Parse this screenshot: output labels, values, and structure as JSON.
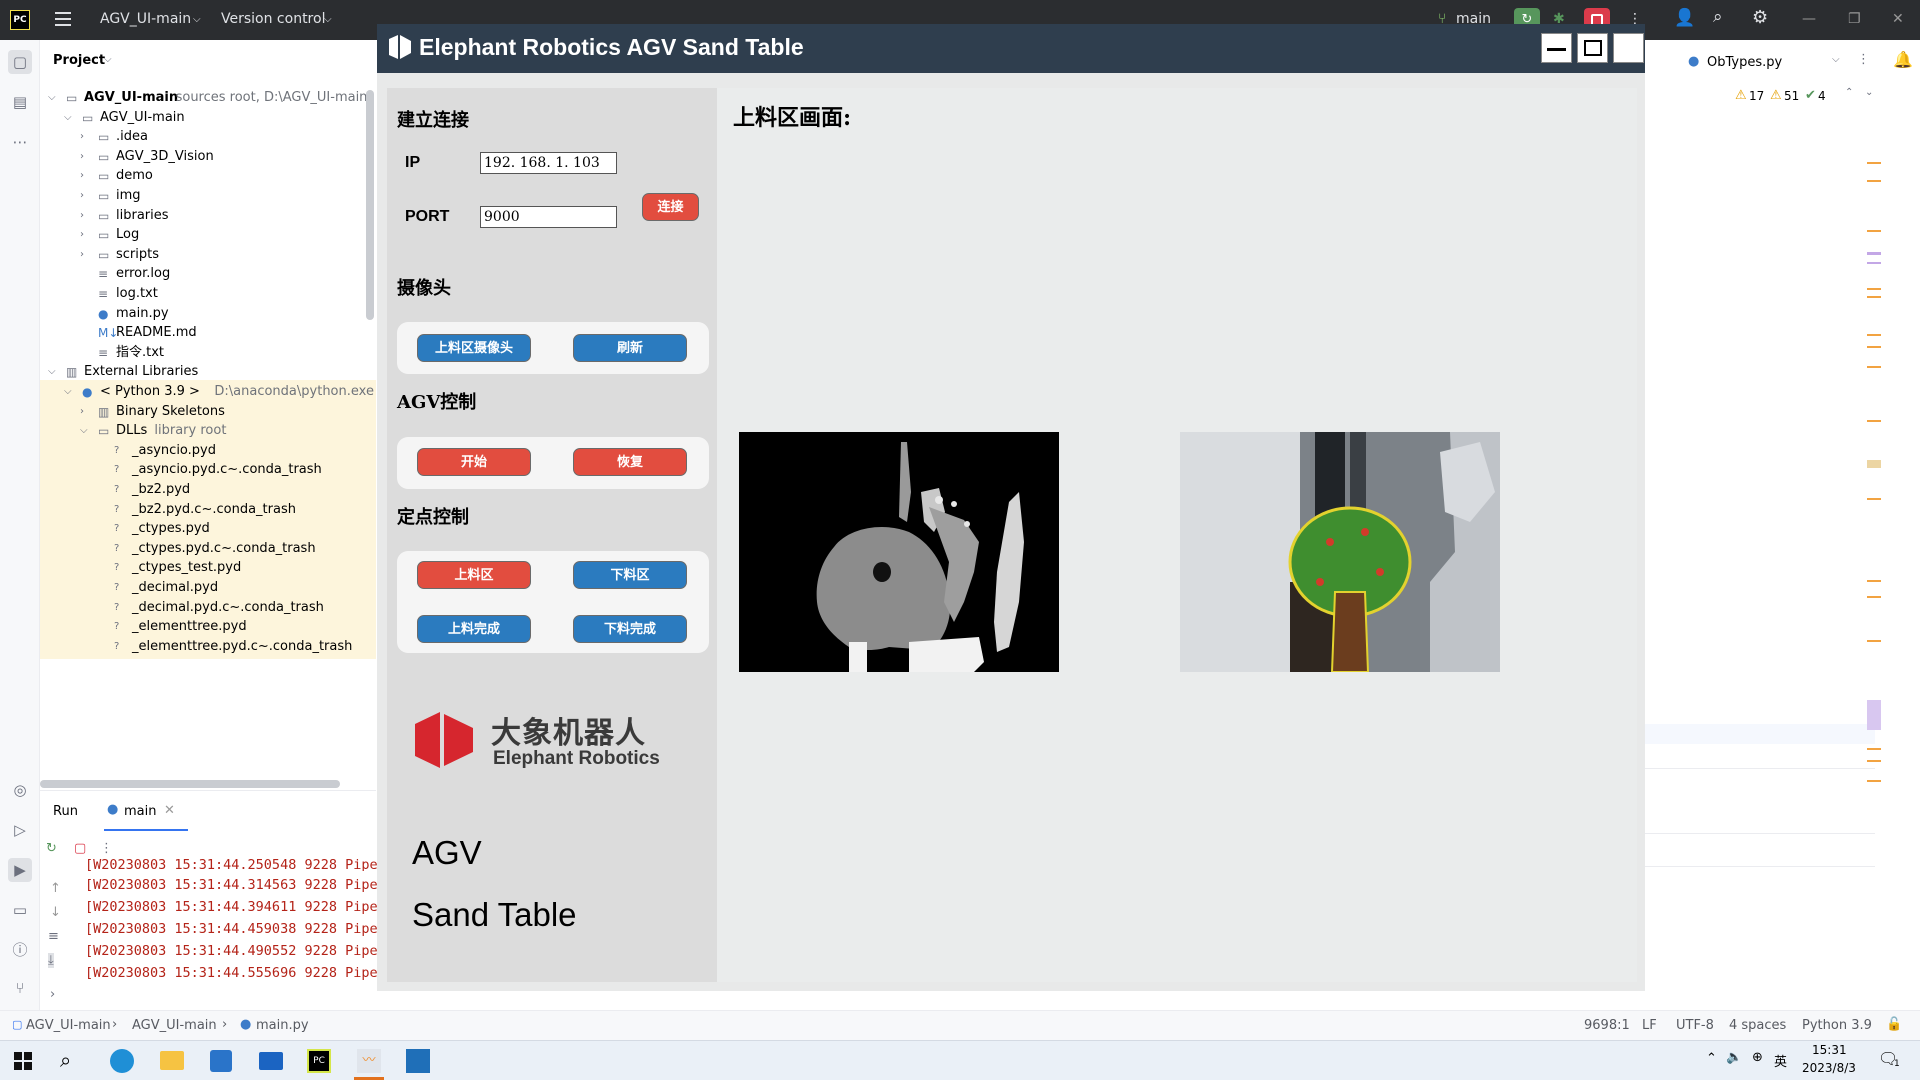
{
  "ide": {
    "project_name": "AGV_UI-main",
    "vcs_label": "Version control",
    "branch": "main",
    "right_tab": "ObTypes.py",
    "inspections": {
      "warnings": "17",
      "weak_warnings": "51",
      "ok": "4"
    }
  },
  "project_panel": {
    "title": "Project",
    "rows": [
      {
        "label": "AGV_UI-main",
        "extra": "sources root,  D:\\AGV_UI-main",
        "kind": "folder",
        "arrow": "v",
        "level": 0,
        "bold": true
      },
      {
        "label": "AGV_UI-main",
        "extra": "",
        "kind": "folder",
        "arrow": "v",
        "level": 1
      },
      {
        "label": ".idea",
        "extra": "",
        "kind": "folder",
        "arrow": ">",
        "level": 2
      },
      {
        "label": "AGV_3D_Vision",
        "extra": "",
        "kind": "folder",
        "arrow": ">",
        "level": 2
      },
      {
        "label": "demo",
        "extra": "",
        "kind": "folder",
        "arrow": ">",
        "level": 2
      },
      {
        "label": "img",
        "extra": "",
        "kind": "folder",
        "arrow": ">",
        "level": 2
      },
      {
        "label": "libraries",
        "extra": "",
        "kind": "folder",
        "arrow": ">",
        "level": 2
      },
      {
        "label": "Log",
        "extra": "",
        "kind": "folder",
        "arrow": ">",
        "level": 2
      },
      {
        "label": "scripts",
        "extra": "",
        "kind": "folder",
        "arrow": ">",
        "level": 2
      },
      {
        "label": "error.log",
        "extra": "",
        "kind": "text",
        "arrow": "",
        "level": 2
      },
      {
        "label": "log.txt",
        "extra": "",
        "kind": "text",
        "arrow": "",
        "level": 2
      },
      {
        "label": "main.py",
        "extra": "",
        "kind": "python",
        "arrow": "",
        "level": 2
      },
      {
        "label": "README.md",
        "extra": "",
        "kind": "md",
        "arrow": "",
        "level": 2
      },
      {
        "label": "指令.txt",
        "extra": "",
        "kind": "text",
        "arrow": "",
        "level": 2
      },
      {
        "label": "External Libraries",
        "extra": "",
        "kind": "lib",
        "arrow": "v",
        "level": 0
      },
      {
        "label": "< Python 3.9 >",
        "extra": "D:\\anaconda\\python.exe",
        "kind": "python",
        "arrow": "v",
        "level": 1,
        "hl": true
      },
      {
        "label": "Binary Skeletons",
        "extra": "",
        "kind": "lib",
        "arrow": ">",
        "level": 2,
        "hl": true
      },
      {
        "label": "DLLs",
        "extra": "library root",
        "kind": "folder",
        "arrow": "v",
        "level": 2,
        "hl": true
      },
      {
        "label": "_asyncio.pyd",
        "extra": "",
        "kind": "unknown",
        "arrow": "",
        "level": 3,
        "hl": true
      },
      {
        "label": "_asyncio.pyd.c~.conda_trash",
        "extra": "",
        "kind": "unknown",
        "arrow": "",
        "level": 3,
        "hl": true
      },
      {
        "label": "_bz2.pyd",
        "extra": "",
        "kind": "unknown",
        "arrow": "",
        "level": 3,
        "hl": true
      },
      {
        "label": "_bz2.pyd.c~.conda_trash",
        "extra": "",
        "kind": "unknown",
        "arrow": "",
        "level": 3,
        "hl": true
      },
      {
        "label": "_ctypes.pyd",
        "extra": "",
        "kind": "unknown",
        "arrow": "",
        "level": 3,
        "hl": true
      },
      {
        "label": "_ctypes.pyd.c~.conda_trash",
        "extra": "",
        "kind": "unknown",
        "arrow": "",
        "level": 3,
        "hl": true
      },
      {
        "label": "_ctypes_test.pyd",
        "extra": "",
        "kind": "unknown",
        "arrow": "",
        "level": 3,
        "hl": true
      },
      {
        "label": "_decimal.pyd",
        "extra": "",
        "kind": "unknown",
        "arrow": "",
        "level": 3,
        "hl": true
      },
      {
        "label": "_decimal.pyd.c~.conda_trash",
        "extra": "",
        "kind": "unknown",
        "arrow": "",
        "level": 3,
        "hl": true
      },
      {
        "label": "_elementtree.pyd",
        "extra": "",
        "kind": "unknown",
        "arrow": "",
        "level": 3,
        "hl": true
      },
      {
        "label": "_elementtree.pyd.c~.conda_trash",
        "extra": "",
        "kind": "unknown",
        "arrow": "",
        "level": 3,
        "hl": true
      }
    ]
  },
  "run_panel": {
    "title": "Run",
    "tab": "main",
    "lines": [
      "[W20230803 15:31:44.250548  9228 Pipe",
      "[W20230803 15:31:44.314563  9228 Pipe",
      "[W20230803 15:31:44.394611  9228 Pipe",
      "[W20230803 15:31:44.459038  9228 Pipe",
      "[W20230803 15:31:44.490552  9228 Pipe",
      "[W20230803 15:31:44.555696  9228 Pipe"
    ]
  },
  "statusbar": {
    "crumb1": "AGV_UI-main",
    "crumb2": "AGV_UI-main",
    "crumb3": "main.py",
    "position": "9698:1",
    "line_sep": "LF",
    "encoding": "UTF-8",
    "indent": "4 spaces",
    "interpreter": "Python 3.9"
  },
  "taskbar": {
    "time": "15:31",
    "date": "2023/8/3",
    "lang": "英",
    "notif_count": "1"
  },
  "app": {
    "title": "Elephant Robotics AGV Sand Table",
    "connect_section": "建立连接",
    "ip_label": "IP",
    "ip_value": "192. 168. 1. 103",
    "port_label": "PORT",
    "port_value": "9000",
    "connect_btn": "连接",
    "camera_section": "摄像头",
    "feed_camera_btn": "上料区摄像头",
    "refresh_btn": "刷新",
    "agv_section": "AGV控制",
    "start_btn": "开始",
    "restore_btn": "恢复",
    "point_section": "定点控制",
    "load_area_btn": "上料区",
    "unload_area_btn": "下料区",
    "load_done_btn": "上料完成",
    "unload_done_btn": "下料完成",
    "logo_cn": "大象机器人",
    "logo_en": "Elephant Robotics",
    "brand_line1": "AGV",
    "brand_line2": "Sand Table",
    "view_title": "上料区画面:",
    "colors": {
      "blue": "#2b7bbf",
      "red": "#e24d3f",
      "titlebar": "#2f3e4e",
      "logo_red": "#d6262e"
    }
  }
}
